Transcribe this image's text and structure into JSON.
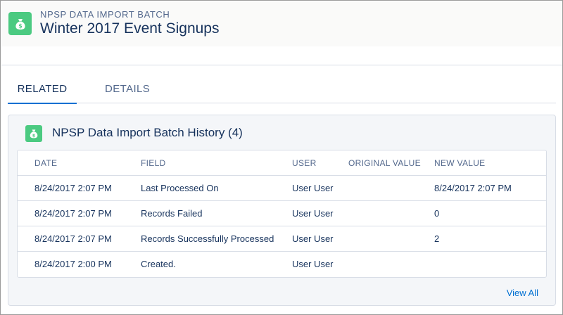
{
  "header": {
    "object_label": "NPSP DATA IMPORT BATCH",
    "title": "Winter 2017 Event Signups",
    "icon": "money-bag-icon",
    "icon_color": "#4bca81"
  },
  "tabs": [
    {
      "label": "RELATED",
      "active": true
    },
    {
      "label": "DETAILS",
      "active": false
    }
  ],
  "related_card": {
    "title": "NPSP Data Import Batch History (4)",
    "icon": "money-bag-icon",
    "columns": [
      "DATE",
      "FIELD",
      "USER",
      "ORIGINAL VALUE",
      "NEW VALUE"
    ],
    "rows": [
      {
        "date": "8/24/2017 2:07 PM",
        "field": "Last Processed On",
        "user": "User User",
        "original": "",
        "new": "8/24/2017 2:07 PM"
      },
      {
        "date": "8/24/2017 2:07 PM",
        "field": "Records Failed",
        "user": "User User",
        "original": "",
        "new": "0"
      },
      {
        "date": "8/24/2017 2:07 PM",
        "field": "Records Successfully Processed",
        "user": "User User",
        "original": "",
        "new": "2"
      },
      {
        "date": "8/24/2017 2:00 PM",
        "field": "Created.",
        "user": "User User",
        "original": "",
        "new": ""
      }
    ],
    "view_all_label": "View All"
  },
  "colors": {
    "accent": "#0070d2",
    "text": "#16325c",
    "muted": "#54698d",
    "border": "#d8dde6"
  }
}
